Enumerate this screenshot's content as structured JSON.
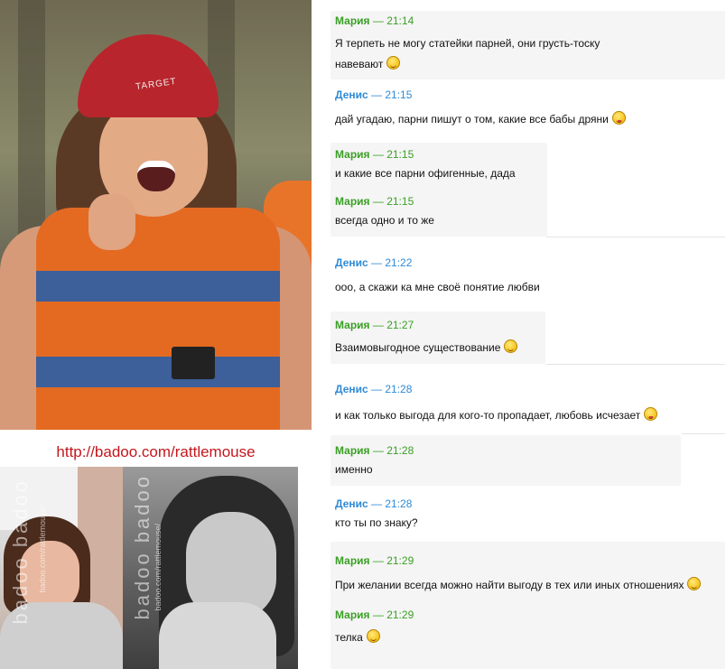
{
  "collage": {
    "badoo_link": "http://badoo.com/rattlemouse",
    "helmet_brand": "TARGET",
    "watermark_1": "badoo badoo",
    "watermark_2": "badoo badoo",
    "watermark_url": "badoo.com/rattlemouse/"
  },
  "chat": {
    "messages": [
      {
        "author": "Мария",
        "time": "— 21:14",
        "text": "Я терпеть не могу статейки парней, они грусть-тоску",
        "text2": "навевают",
        "smiley": "smile"
      },
      {
        "author": "Денис",
        "time": "— 21:15",
        "text": "дай угадаю, парни пишут о том, какие все бабы дряни",
        "smiley": "tongue"
      },
      {
        "author": "Мария",
        "time": "— 21:15",
        "text": "и какие все парни офигенные, дада"
      },
      {
        "author": "Мария",
        "time": "— 21:15",
        "text": "всегда одно и то же"
      },
      {
        "author": "Денис",
        "time": "— 21:22",
        "text": "ооо, а скажи ка мне своё понятие любви"
      },
      {
        "author": "Мария",
        "time": "— 21:27",
        "text": "Взаимовыгодное существование",
        "smiley": "smile"
      },
      {
        "author": "Денис",
        "time": "— 21:28",
        "text": "и как только выгода для кого-то пропадает, любовь исчезает",
        "smiley": "tongue"
      },
      {
        "author": "Мария",
        "time": "— 21:28",
        "text": "именно"
      },
      {
        "author": "Денис",
        "time": "— 21:28",
        "text": "кто ты по знаку?"
      },
      {
        "author": "Мария",
        "time": "— 21:29",
        "text": "При желании всегда можно найти выгоду в тех или иных отношениях",
        "smiley": "smile"
      },
      {
        "author": "Мария",
        "time": "— 21:29",
        "text": "телка",
        "smiley": "smile"
      }
    ]
  },
  "colors": {
    "maria": "#3aa025",
    "denis": "#2f8ad6",
    "link": "#c4161c"
  },
  "icons": {
    "smile": "smile-emoticon-icon",
    "tongue": "tongue-emoticon-icon"
  }
}
